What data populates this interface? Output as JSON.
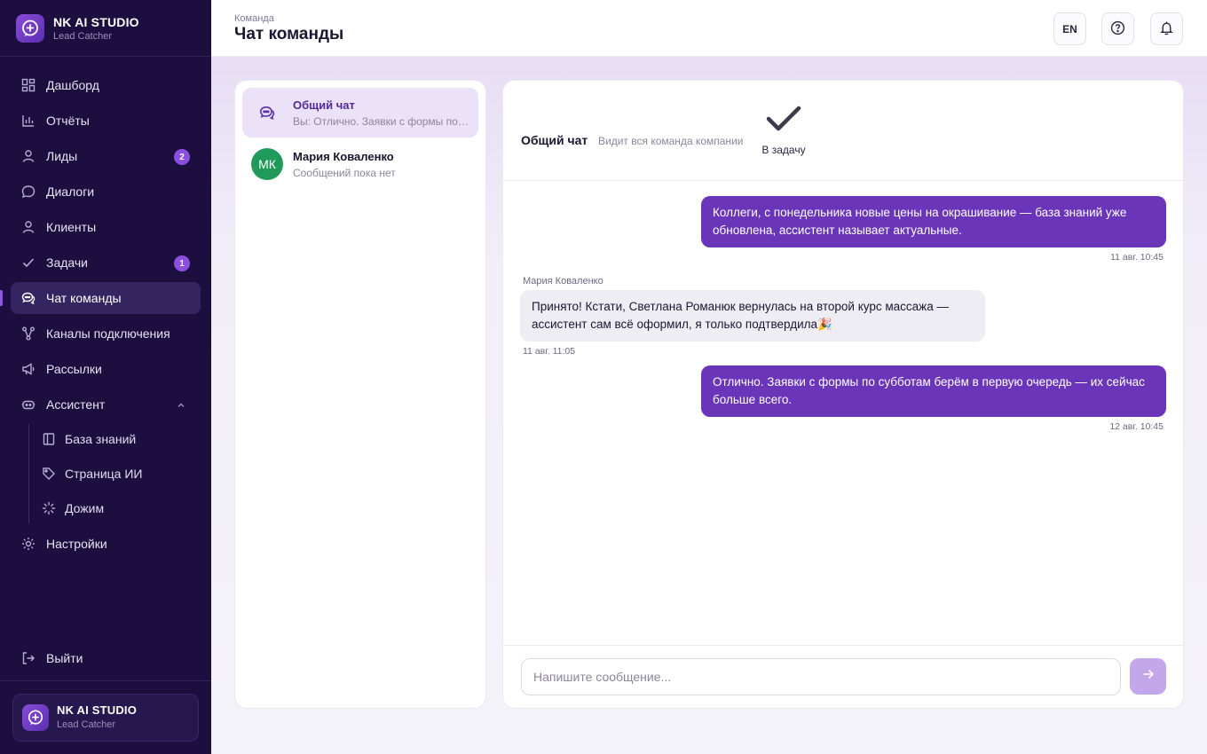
{
  "brand": {
    "name": "NK AI STUDIO",
    "subtitle": "Lead Catcher"
  },
  "sidebar": {
    "items": [
      {
        "label": "Дашборд",
        "icon": "dashboard-icon"
      },
      {
        "label": "Отчёты",
        "icon": "bar-chart-icon"
      },
      {
        "label": "Лиды",
        "icon": "user-icon",
        "badge": "2"
      },
      {
        "label": "Диалоги",
        "icon": "message-icon"
      },
      {
        "label": "Клиенты",
        "icon": "user-icon"
      },
      {
        "label": "Задачи",
        "icon": "check-icon",
        "badge": "1"
      },
      {
        "label": "Чат команды",
        "icon": "chat-bubbles-icon",
        "active": true
      },
      {
        "label": "Каналы подключения",
        "icon": "channels-icon"
      },
      {
        "label": "Рассылки",
        "icon": "megaphone-icon"
      },
      {
        "label": "Ассистент",
        "icon": "bot-icon",
        "expanded": true
      }
    ],
    "sub_items": [
      {
        "label": "База знаний",
        "icon": "book-icon"
      },
      {
        "label": "Страница ИИ",
        "icon": "tag-icon"
      },
      {
        "label": "Дожим",
        "icon": "loader-icon"
      }
    ],
    "settings_label": "Настройки",
    "logout_label": "Выйти"
  },
  "header": {
    "breadcrumb": "Команда",
    "title": "Чат команды",
    "lang_label": "EN"
  },
  "chat_list": [
    {
      "name": "Общий чат",
      "preview": "Вы: Отлично. Заявки с формы по субботам берём в первую очередь — их сейчас больше всего.",
      "active": true
    },
    {
      "name": "Мария Коваленко",
      "initials": "МК",
      "preview": "Сообщений пока нет"
    }
  ],
  "chat": {
    "title": "Общий чат",
    "description": "Видит вся команда компании",
    "task_label": "В задачу",
    "messages": [
      {
        "direction": "out",
        "text": "Коллеги, с понедельника новые цены на окрашивание — база знаний уже обновлена, ассистент называет актуальные.",
        "time": "11 авг. 10:45"
      },
      {
        "direction": "in",
        "author": "Мария Коваленко",
        "text": "Принято! Кстати, Светлана Романюк вернулась на второй курс массажа — ассистент сам всё оформил, я только подтвердила🎉",
        "time": "11 авг. 11:05"
      },
      {
        "direction": "out",
        "text": "Отлично. Заявки с формы по субботам берём в первую очередь — их сейчас больше всего.",
        "time": "12 авг. 10:45"
      }
    ],
    "input_placeholder": "Напишите сообщение..."
  },
  "colors": {
    "sidebar_bg": "#1c0f3f",
    "accent": "#6a35b8",
    "badge": "#8a4fe0",
    "avatar_green": "#1f9a5a"
  }
}
